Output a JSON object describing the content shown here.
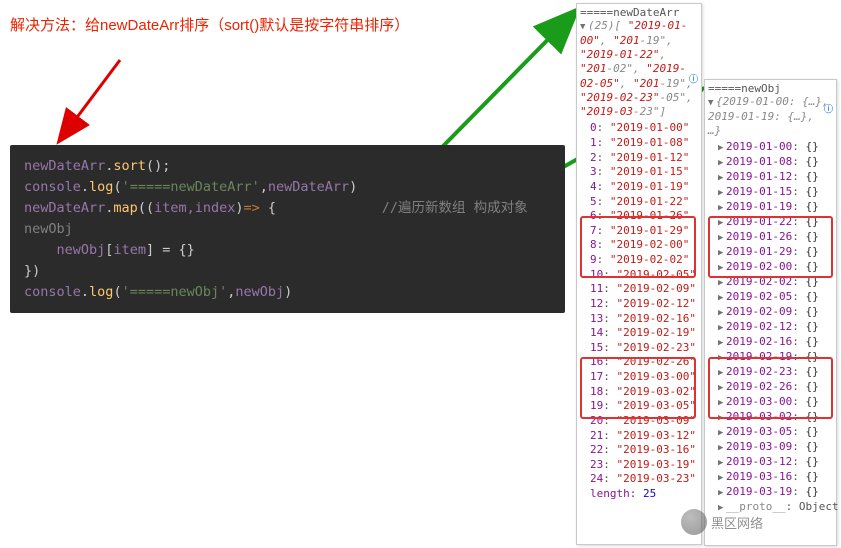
{
  "annotation": "解决方法：给newDateArr排序（sort()默认是按字符串排序）",
  "code": {
    "l1_var": "newDateArr",
    "l1_fn": "sort",
    "l2_obj": "console",
    "l2_fn": "log",
    "l2_str": "'=====newDateArr'",
    "l2_arg": "newDateArr",
    "l3_var": "newDateArr",
    "l3_fn": "map",
    "l3_args": "item,index",
    "l3_cmt": "//遍历新数组 构成对象newObj",
    "l4_var": "newObj",
    "l4_idx": "item",
    "l6_obj": "console",
    "l6_fn": "log",
    "l6_str": "'=====newObj'",
    "l6_arg": "newObj"
  },
  "panel_arr": {
    "header": "=====newDateArr",
    "preview_parts": [
      "(25)",
      "[",
      "\"2019-01-00\"",
      ",",
      "\"201",
      "-19\"",
      ",",
      "\"2019-01-22\"",
      ",",
      "\"201",
      "-02\"",
      ",",
      "\"2019-02-05\"",
      ",",
      "\"201",
      "-19\"",
      ",",
      "\"2019-02-23\"",
      "-05\"",
      ",",
      "\"2019-03",
      "-23\"",
      "]"
    ],
    "rows": [
      {
        "i": "0",
        "v": "\"2019-01-00\""
      },
      {
        "i": "1",
        "v": "\"2019-01-08\""
      },
      {
        "i": "2",
        "v": "\"2019-01-12\""
      },
      {
        "i": "3",
        "v": "\"2019-01-15\""
      },
      {
        "i": "4",
        "v": "\"2019-01-19\""
      },
      {
        "i": "5",
        "v": "\"2019-01-22\""
      },
      {
        "i": "6",
        "v": "\"2019-01-26\""
      },
      {
        "i": "7",
        "v": "\"2019-01-29\""
      },
      {
        "i": "8",
        "v": "\"2019-02-00\""
      },
      {
        "i": "9",
        "v": "\"2019-02-02\""
      },
      {
        "i": "10",
        "v": "\"2019-02-05\""
      },
      {
        "i": "11",
        "v": "\"2019-02-09\""
      },
      {
        "i": "12",
        "v": "\"2019-02-12\""
      },
      {
        "i": "13",
        "v": "\"2019-02-16\""
      },
      {
        "i": "14",
        "v": "\"2019-02-19\""
      },
      {
        "i": "15",
        "v": "\"2019-02-23\""
      },
      {
        "i": "16",
        "v": "\"2019-02-26\""
      },
      {
        "i": "17",
        "v": "\"2019-03-00\""
      },
      {
        "i": "18",
        "v": "\"2019-03-02\""
      },
      {
        "i": "19",
        "v": "\"2019-03-05\""
      },
      {
        "i": "20",
        "v": "\"2019-03-09\""
      },
      {
        "i": "21",
        "v": "\"2019-03-12\""
      },
      {
        "i": "22",
        "v": "\"2019-03-16\""
      },
      {
        "i": "23",
        "v": "\"2019-03-19\""
      },
      {
        "i": "24",
        "v": "\"2019-03-23\""
      }
    ],
    "length_label": "length",
    "length_val": "25"
  },
  "panel_obj": {
    "header": "=====newObj",
    "preview": "{2019-01-00: {…}, 2019-01-19: {…}, …}",
    "rows": [
      {
        "k": "2019-01-00"
      },
      {
        "k": "2019-01-08"
      },
      {
        "k": "2019-01-12"
      },
      {
        "k": "2019-01-15"
      },
      {
        "k": "2019-01-19"
      },
      {
        "k": "2019-01-22"
      },
      {
        "k": "2019-01-26"
      },
      {
        "k": "2019-01-29"
      },
      {
        "k": "2019-02-00"
      },
      {
        "k": "2019-02-02"
      },
      {
        "k": "2019-02-05"
      },
      {
        "k": "2019-02-09"
      },
      {
        "k": "2019-02-12"
      },
      {
        "k": "2019-02-16"
      },
      {
        "k": "2019-02-19"
      },
      {
        "k": "2019-02-23"
      },
      {
        "k": "2019-02-26"
      },
      {
        "k": "2019-03-00"
      },
      {
        "k": "2019-03-02"
      },
      {
        "k": "2019-03-05"
      },
      {
        "k": "2019-03-09"
      },
      {
        "k": "2019-03-12"
      },
      {
        "k": "2019-03-16"
      },
      {
        "k": "2019-03-19"
      }
    ],
    "proto_label": "__proto__",
    "proto_val": "Object"
  },
  "watermark": "黑区网络"
}
